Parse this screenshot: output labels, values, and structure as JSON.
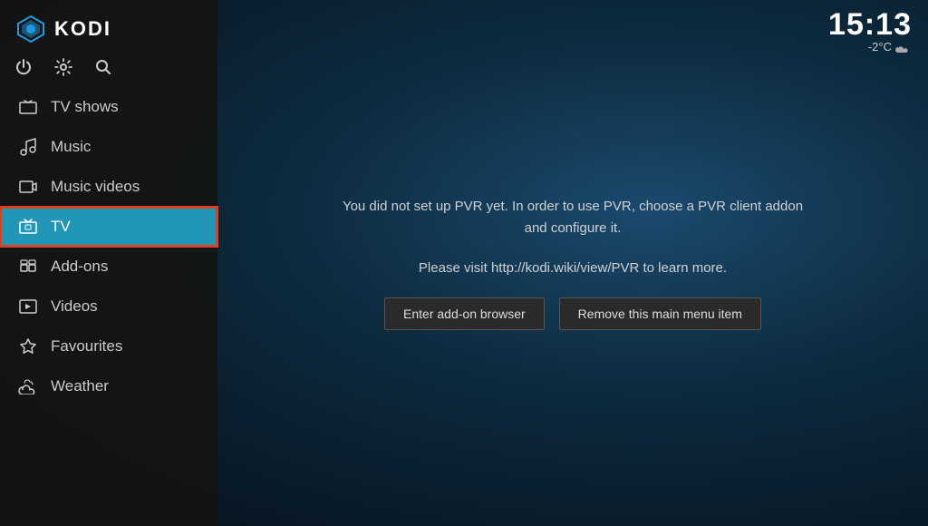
{
  "app": {
    "title": "KODI"
  },
  "clock": {
    "time": "15:13",
    "weather": "-2°C",
    "weather_icon": "cloud-icon"
  },
  "sidebar": {
    "nav_items": [
      {
        "id": "tv-shows",
        "label": "TV shows",
        "icon": "tv-icon",
        "active": false
      },
      {
        "id": "music",
        "label": "Music",
        "icon": "music-icon",
        "active": false
      },
      {
        "id": "music-videos",
        "label": "Music videos",
        "icon": "music-video-icon",
        "active": false
      },
      {
        "id": "tv",
        "label": "TV",
        "icon": "tv-antenna-icon",
        "active": true
      },
      {
        "id": "add-ons",
        "label": "Add-ons",
        "icon": "addon-icon",
        "active": false
      },
      {
        "id": "videos",
        "label": "Videos",
        "icon": "video-icon",
        "active": false
      },
      {
        "id": "favourites",
        "label": "Favourites",
        "icon": "star-icon",
        "active": false
      },
      {
        "id": "weather",
        "label": "Weather",
        "icon": "weather-icon",
        "active": false
      }
    ]
  },
  "main": {
    "pvr_message": "You did not set up PVR yet. In order to use PVR, choose a PVR client addon and configure it.\nPlease visit http://kodi.wiki/view/PVR to learn more.",
    "pvr_message_line1": "You did not set up PVR yet. In order to use PVR, choose a PVR client addon and configure it.",
    "pvr_message_line2": "Please visit http://kodi.wiki/view/PVR to learn more.",
    "btn_addon_browser": "Enter add-on browser",
    "btn_remove_menu_item": "Remove this main menu item"
  },
  "iconbar": {
    "power_label": "power",
    "settings_label": "settings",
    "search_label": "search"
  }
}
